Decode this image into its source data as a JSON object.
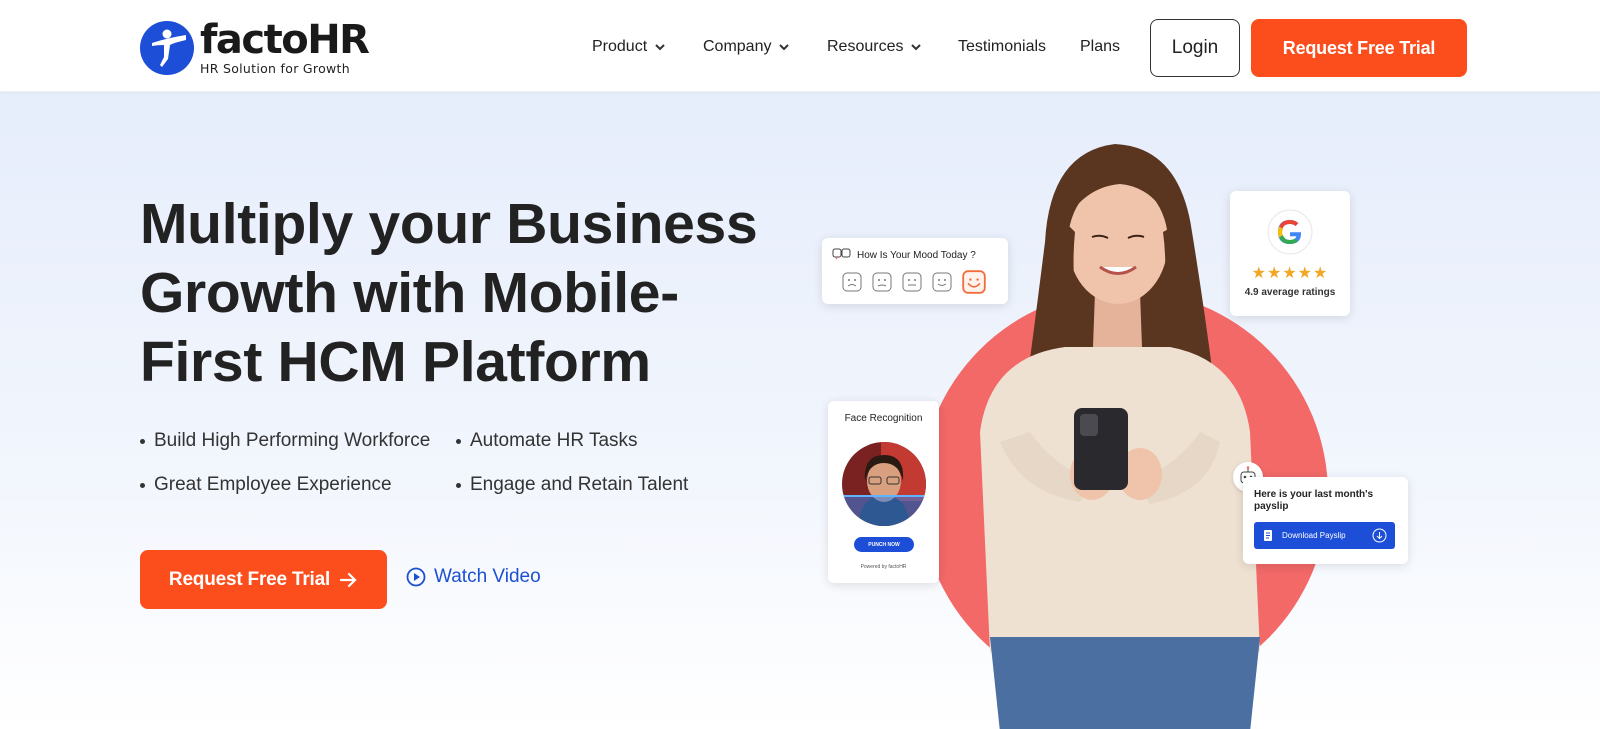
{
  "brand": {
    "name": "factoHR",
    "tagline": "HR Solution for Growth",
    "primary_color": "#1d4ed8",
    "accent_color": "#fc4d1c"
  },
  "nav": {
    "items": [
      {
        "label": "Product",
        "has_dropdown": true
      },
      {
        "label": "Company",
        "has_dropdown": true
      },
      {
        "label": "Resources",
        "has_dropdown": true
      },
      {
        "label": "Testimonials",
        "has_dropdown": false
      },
      {
        "label": "Plans",
        "has_dropdown": false
      }
    ],
    "login_label": "Login",
    "trial_label": "Request Free Trial"
  },
  "hero": {
    "title_lines": [
      "Multiply your Business",
      "Growth with Mobile-",
      "First HCM Platform"
    ],
    "bullets": [
      "Build High Performing Workforce",
      "Automate HR Tasks",
      "Great Employee Experience",
      "Engage and Retain Talent"
    ],
    "cta_label": "Request Free Trial",
    "watch_label": "Watch Video"
  },
  "visual": {
    "mood_title": "How Is Your Mood Today ?",
    "rating_stars": "★★★★★",
    "rating_text": "4.9 average ratings",
    "face_title": "Face Recognition",
    "punch_label": "PUNCH NOW",
    "powered_label": "Powered by factoHR",
    "payslip_text": "Here is your last month's payslip",
    "download_label": "Download Payslip",
    "circle_color": "#f26968"
  }
}
